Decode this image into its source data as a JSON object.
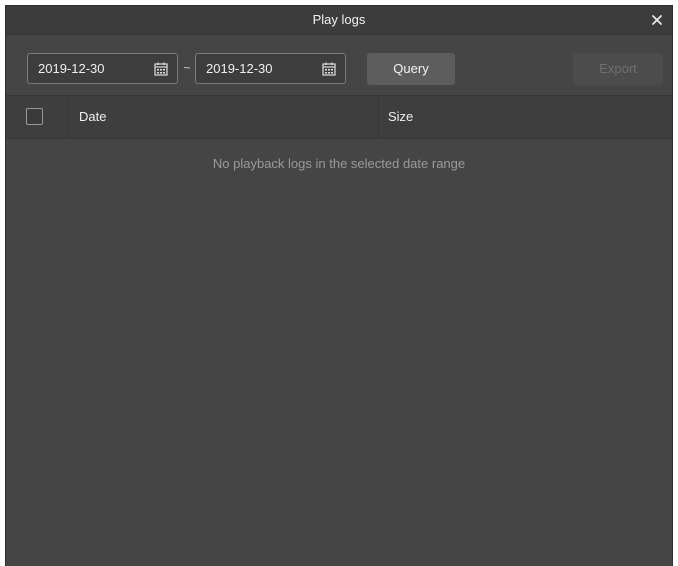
{
  "window": {
    "title": "Play logs",
    "close_icon": "close-icon"
  },
  "toolbar": {
    "start_date": "2019-12-30",
    "end_date": "2019-12-30",
    "range_separator": "~",
    "calendar_icon": "calendar-icon",
    "query_label": "Query",
    "export_label": "Export",
    "export_enabled": false
  },
  "table": {
    "columns": [
      "Date",
      "Size"
    ],
    "select_all_checked": false,
    "rows": [],
    "empty_message": "No playback logs in the selected date range"
  },
  "colors": {
    "background": "#454545",
    "titlebar": "#3c3c3c",
    "header": "#3e3e3e",
    "query_button": "#5d5d5d",
    "export_button_disabled": "#4c4c4c"
  }
}
